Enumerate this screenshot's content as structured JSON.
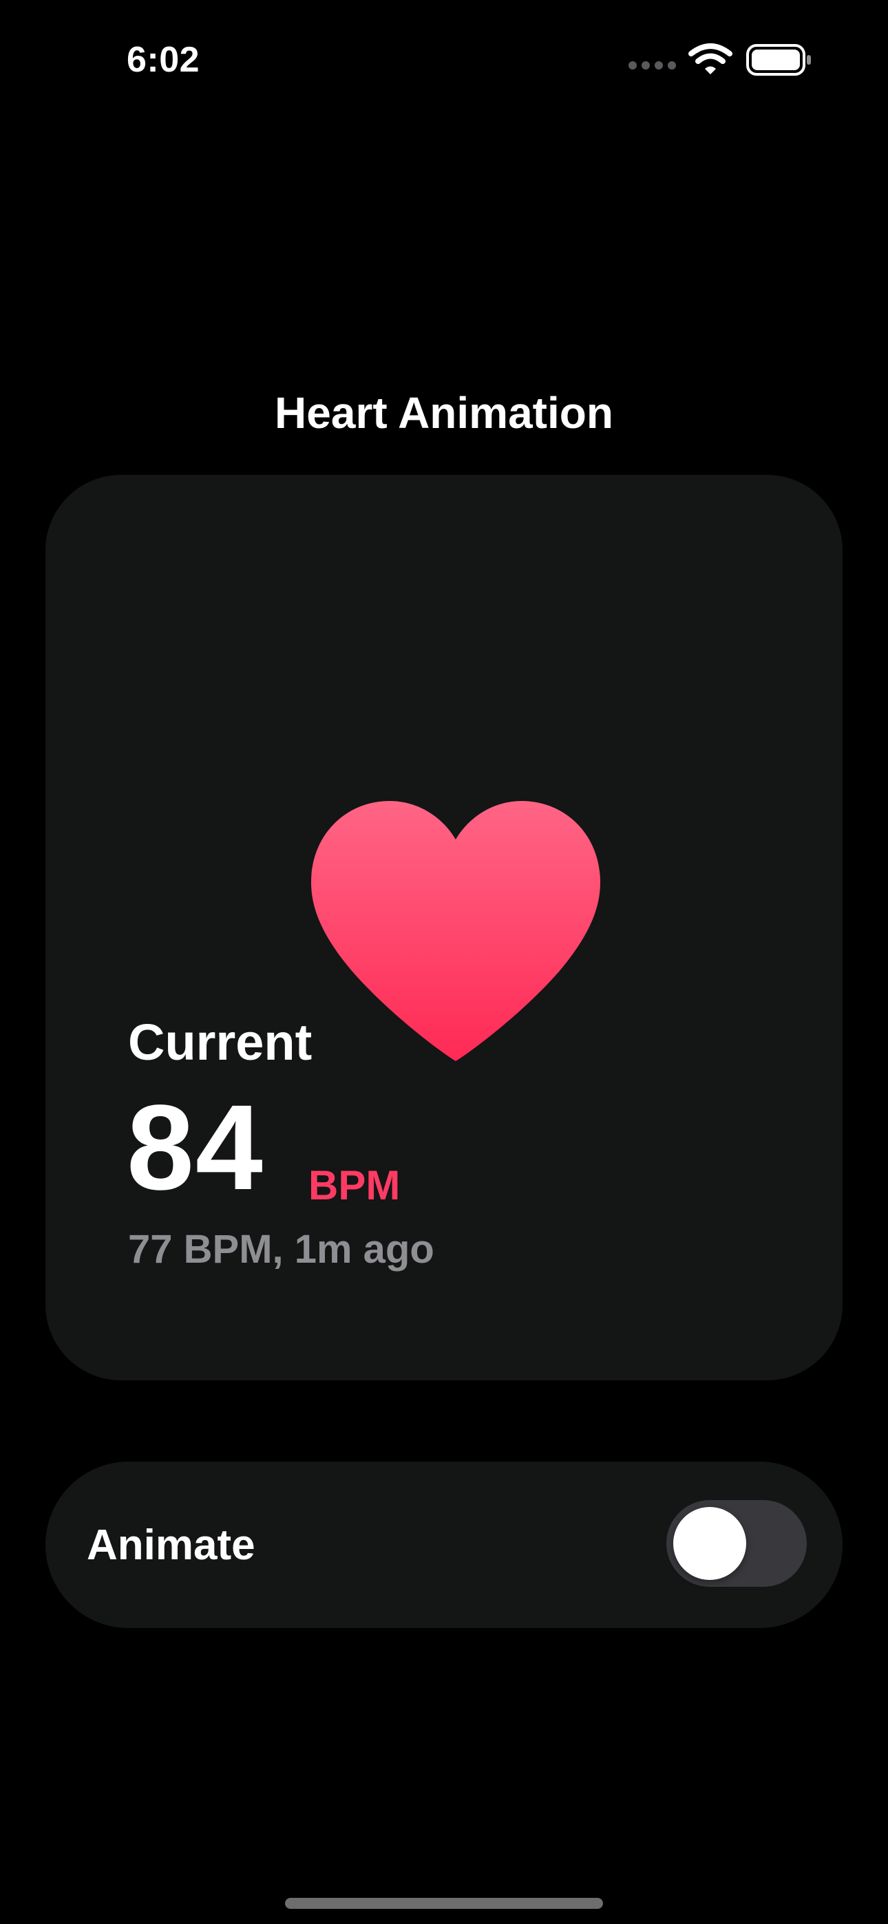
{
  "status_bar": {
    "time": "6:02",
    "icons": [
      "cellular-signal-icon",
      "wifi-icon",
      "battery-icon"
    ]
  },
  "title": "Heart Animation",
  "heart_card": {
    "icon": "heart-icon",
    "label": "Current",
    "value": "84",
    "unit": "BPM",
    "previous": "77 BPM, 1m ago"
  },
  "animate_toggle": {
    "label": "Animate",
    "is_on": false
  },
  "colors": {
    "background": "#000000",
    "card": "#141515",
    "accent": "#ff3b64",
    "heart_top": "#ff6585",
    "heart_bottom": "#ff2a55",
    "secondary_text": "#8e8e93",
    "toggle_off": "#39393d"
  }
}
